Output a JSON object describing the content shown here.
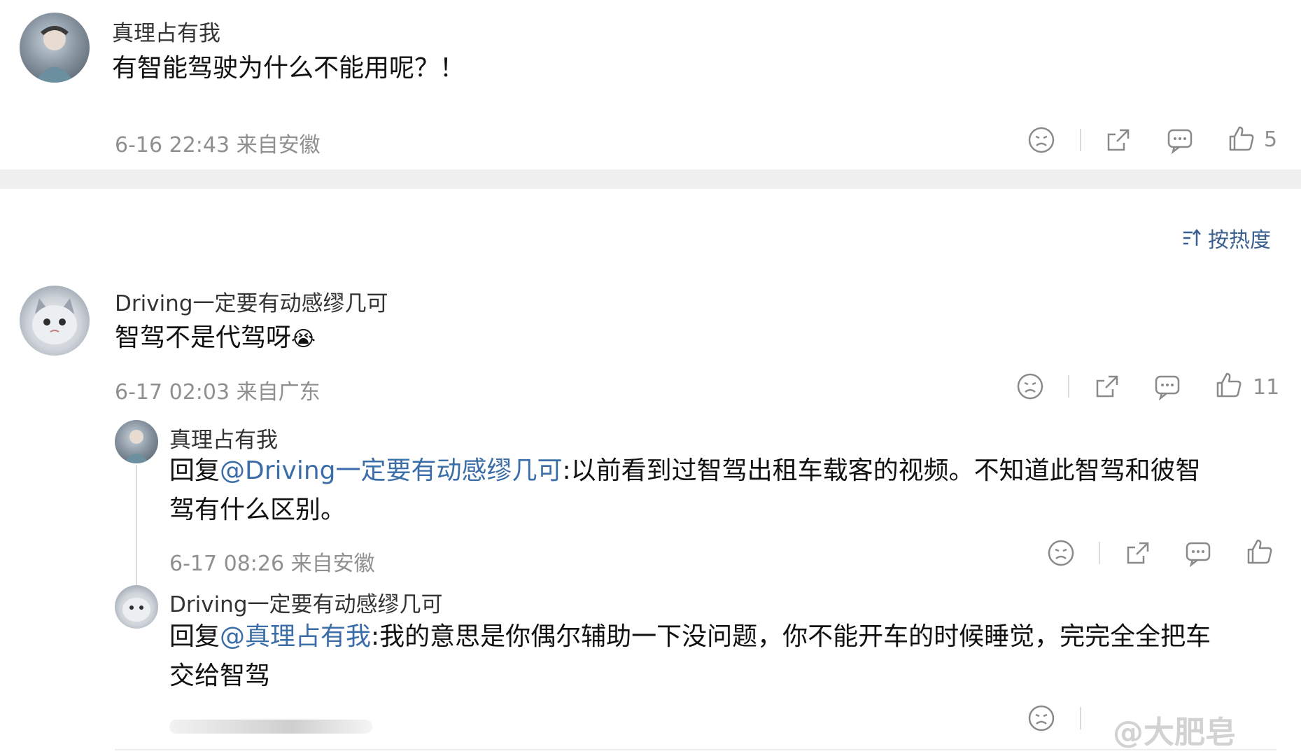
{
  "parent_comment": {
    "user": "真理占有我",
    "text": "有智能驾驶为什么不能用呢？！",
    "meta": "6-16 22:43 来自安徽",
    "likes": "5"
  },
  "sort_label": "按热度",
  "main_comment": {
    "user": "Driving一定要有动感缪几可",
    "text": "智驾不是代驾呀",
    "emoji": "😭",
    "meta": "6-17 02:03 来自广东",
    "likes": "11"
  },
  "replies": [
    {
      "user": "真理占有我",
      "prefix": "回复",
      "mention": "@Driving一定要有动感缪几可",
      "text_line1": ":以前看到过智驾出租车载客的视频。不知道此智驾和彼智",
      "text_line2": "驾有什么区别。",
      "meta": "6-17 08:26 来自安徽"
    },
    {
      "user": "Driving一定要有动感缪几可",
      "prefix": "回复",
      "mention": "@真理占有我",
      "text_line1": ":我的意思是你偶尔辅助一下没问题，你不能开车的时候睡觉，完完全全把车",
      "text_line2": "交给智驾"
    }
  ],
  "watermark": "@大肥皂",
  "colors": {
    "mention": "#3b6ea8",
    "meta": "#8f8f8f",
    "divider": "#efefef"
  }
}
